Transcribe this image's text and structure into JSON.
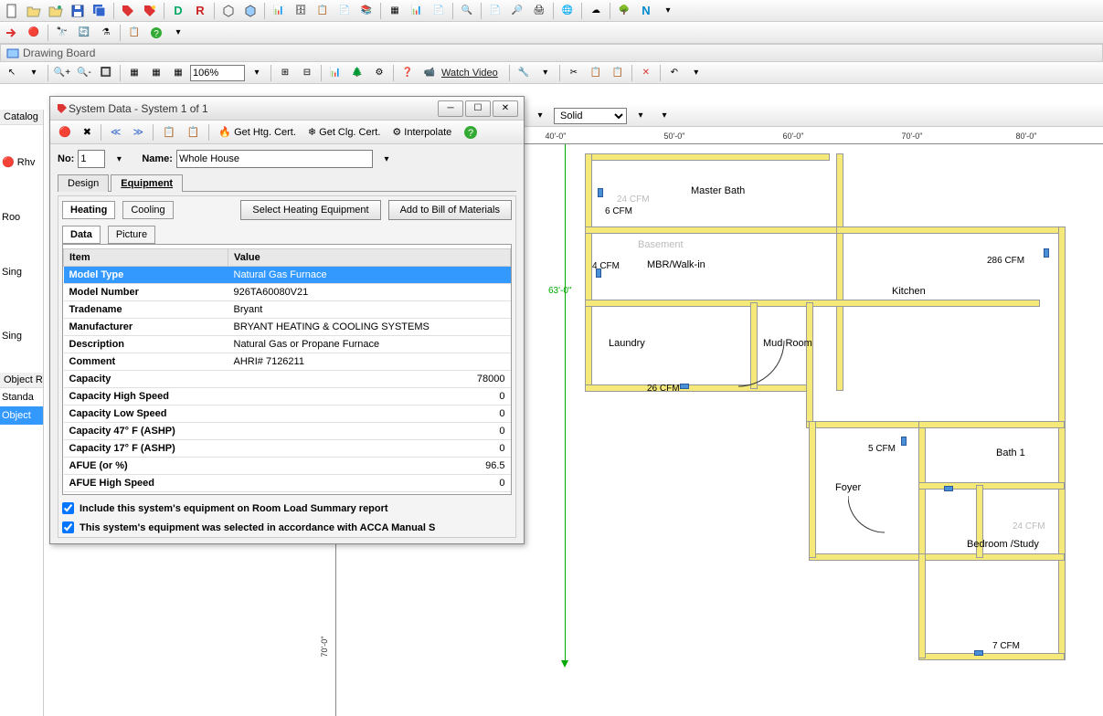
{
  "window": {
    "drawing_board_title": "Drawing Board"
  },
  "toolbar1": {
    "letter_d": "D",
    "letter_r": "R",
    "letter_n": "N"
  },
  "toolbar3": {
    "zoom": "106%",
    "watch_video": "Watch Video"
  },
  "style_bar": {
    "line_style": "Solid"
  },
  "sidebar": {
    "catalog_tab": "Catalog",
    "rhv_label": "Rhv",
    "root": "Roo",
    "sing1": "Sing",
    "sing2": "Sing",
    "object_r": "Object R",
    "standard": "Standa",
    "object_sel": "Object"
  },
  "dialog": {
    "title": "System Data - System 1 of 1",
    "toolbar": {
      "get_htg": "Get Htg. Cert.",
      "get_clg": "Get Clg. Cert.",
      "interpolate": "Interpolate"
    },
    "no_label": "No:",
    "no_value": "1",
    "name_label": "Name:",
    "name_value": "Whole House",
    "tabs": {
      "design": "Design",
      "equipment": "Equipment"
    },
    "subtabs": {
      "heating": "Heating",
      "cooling": "Cooling"
    },
    "buttons": {
      "select_heating": "Select Heating Equipment",
      "add_bom": "Add to Bill of Materials"
    },
    "datatabs": {
      "data": "Data",
      "picture": "Picture"
    },
    "table": {
      "h_item": "Item",
      "h_value": "Value",
      "rows": [
        {
          "item": "Model Type",
          "value": "Natural Gas Furnace",
          "selected": true
        },
        {
          "item": "Model Number",
          "value": "926TA60080V21"
        },
        {
          "item": "Tradename",
          "value": "Bryant"
        },
        {
          "item": "Manufacturer",
          "value": "BRYANT HEATING & COOLING SYSTEMS"
        },
        {
          "item": "Description",
          "value": "Natural Gas or Propane Furnace"
        },
        {
          "item": "Comment",
          "value": "AHRI# 7126211"
        },
        {
          "item": "Capacity",
          "value": "78000",
          "num": true
        },
        {
          "item": "Capacity High Speed",
          "value": "0",
          "num": true
        },
        {
          "item": "Capacity Low Speed",
          "value": "0",
          "num": true
        },
        {
          "item": "Capacity 47° F (ASHP)",
          "value": "0",
          "num": true
        },
        {
          "item": "Capacity 17° F (ASHP)",
          "value": "0",
          "num": true
        },
        {
          "item": "AFUE (or %)",
          "value": "96.5",
          "num": true
        },
        {
          "item": "AFUE High Speed",
          "value": "0",
          "num": true
        }
      ]
    },
    "check1": "Include this system's equipment on Room Load Summary report",
    "check2": "This system's equipment was selected in accordance with ACCA Manual S"
  },
  "ruler_h": [
    "40'-0\"",
    "50'-0\"",
    "60'-0\"",
    "70'-0\"",
    "80'-0\""
  ],
  "ruler_v": [
    "63'-0\"",
    "70'-0\""
  ],
  "rooms": {
    "master_bath": "Master Bath",
    "basement": "Basement",
    "mbr_walkin": "MBR/Walk-in",
    "kitchen": "Kitchen",
    "laundry": "Laundry",
    "mud_room": "Mud Room",
    "foyer": "Foyer",
    "bath1": "Bath 1",
    "bedroom_study": "Bedroom /Study"
  },
  "cfm": {
    "c24a": "24 CFM",
    "c6": "6 CFM",
    "c4": "4 CFM",
    "c286": "286 CFM",
    "c26": "26 CFM",
    "c5": "5 CFM",
    "c24b": "24 CFM",
    "c7": "7 CFM"
  }
}
